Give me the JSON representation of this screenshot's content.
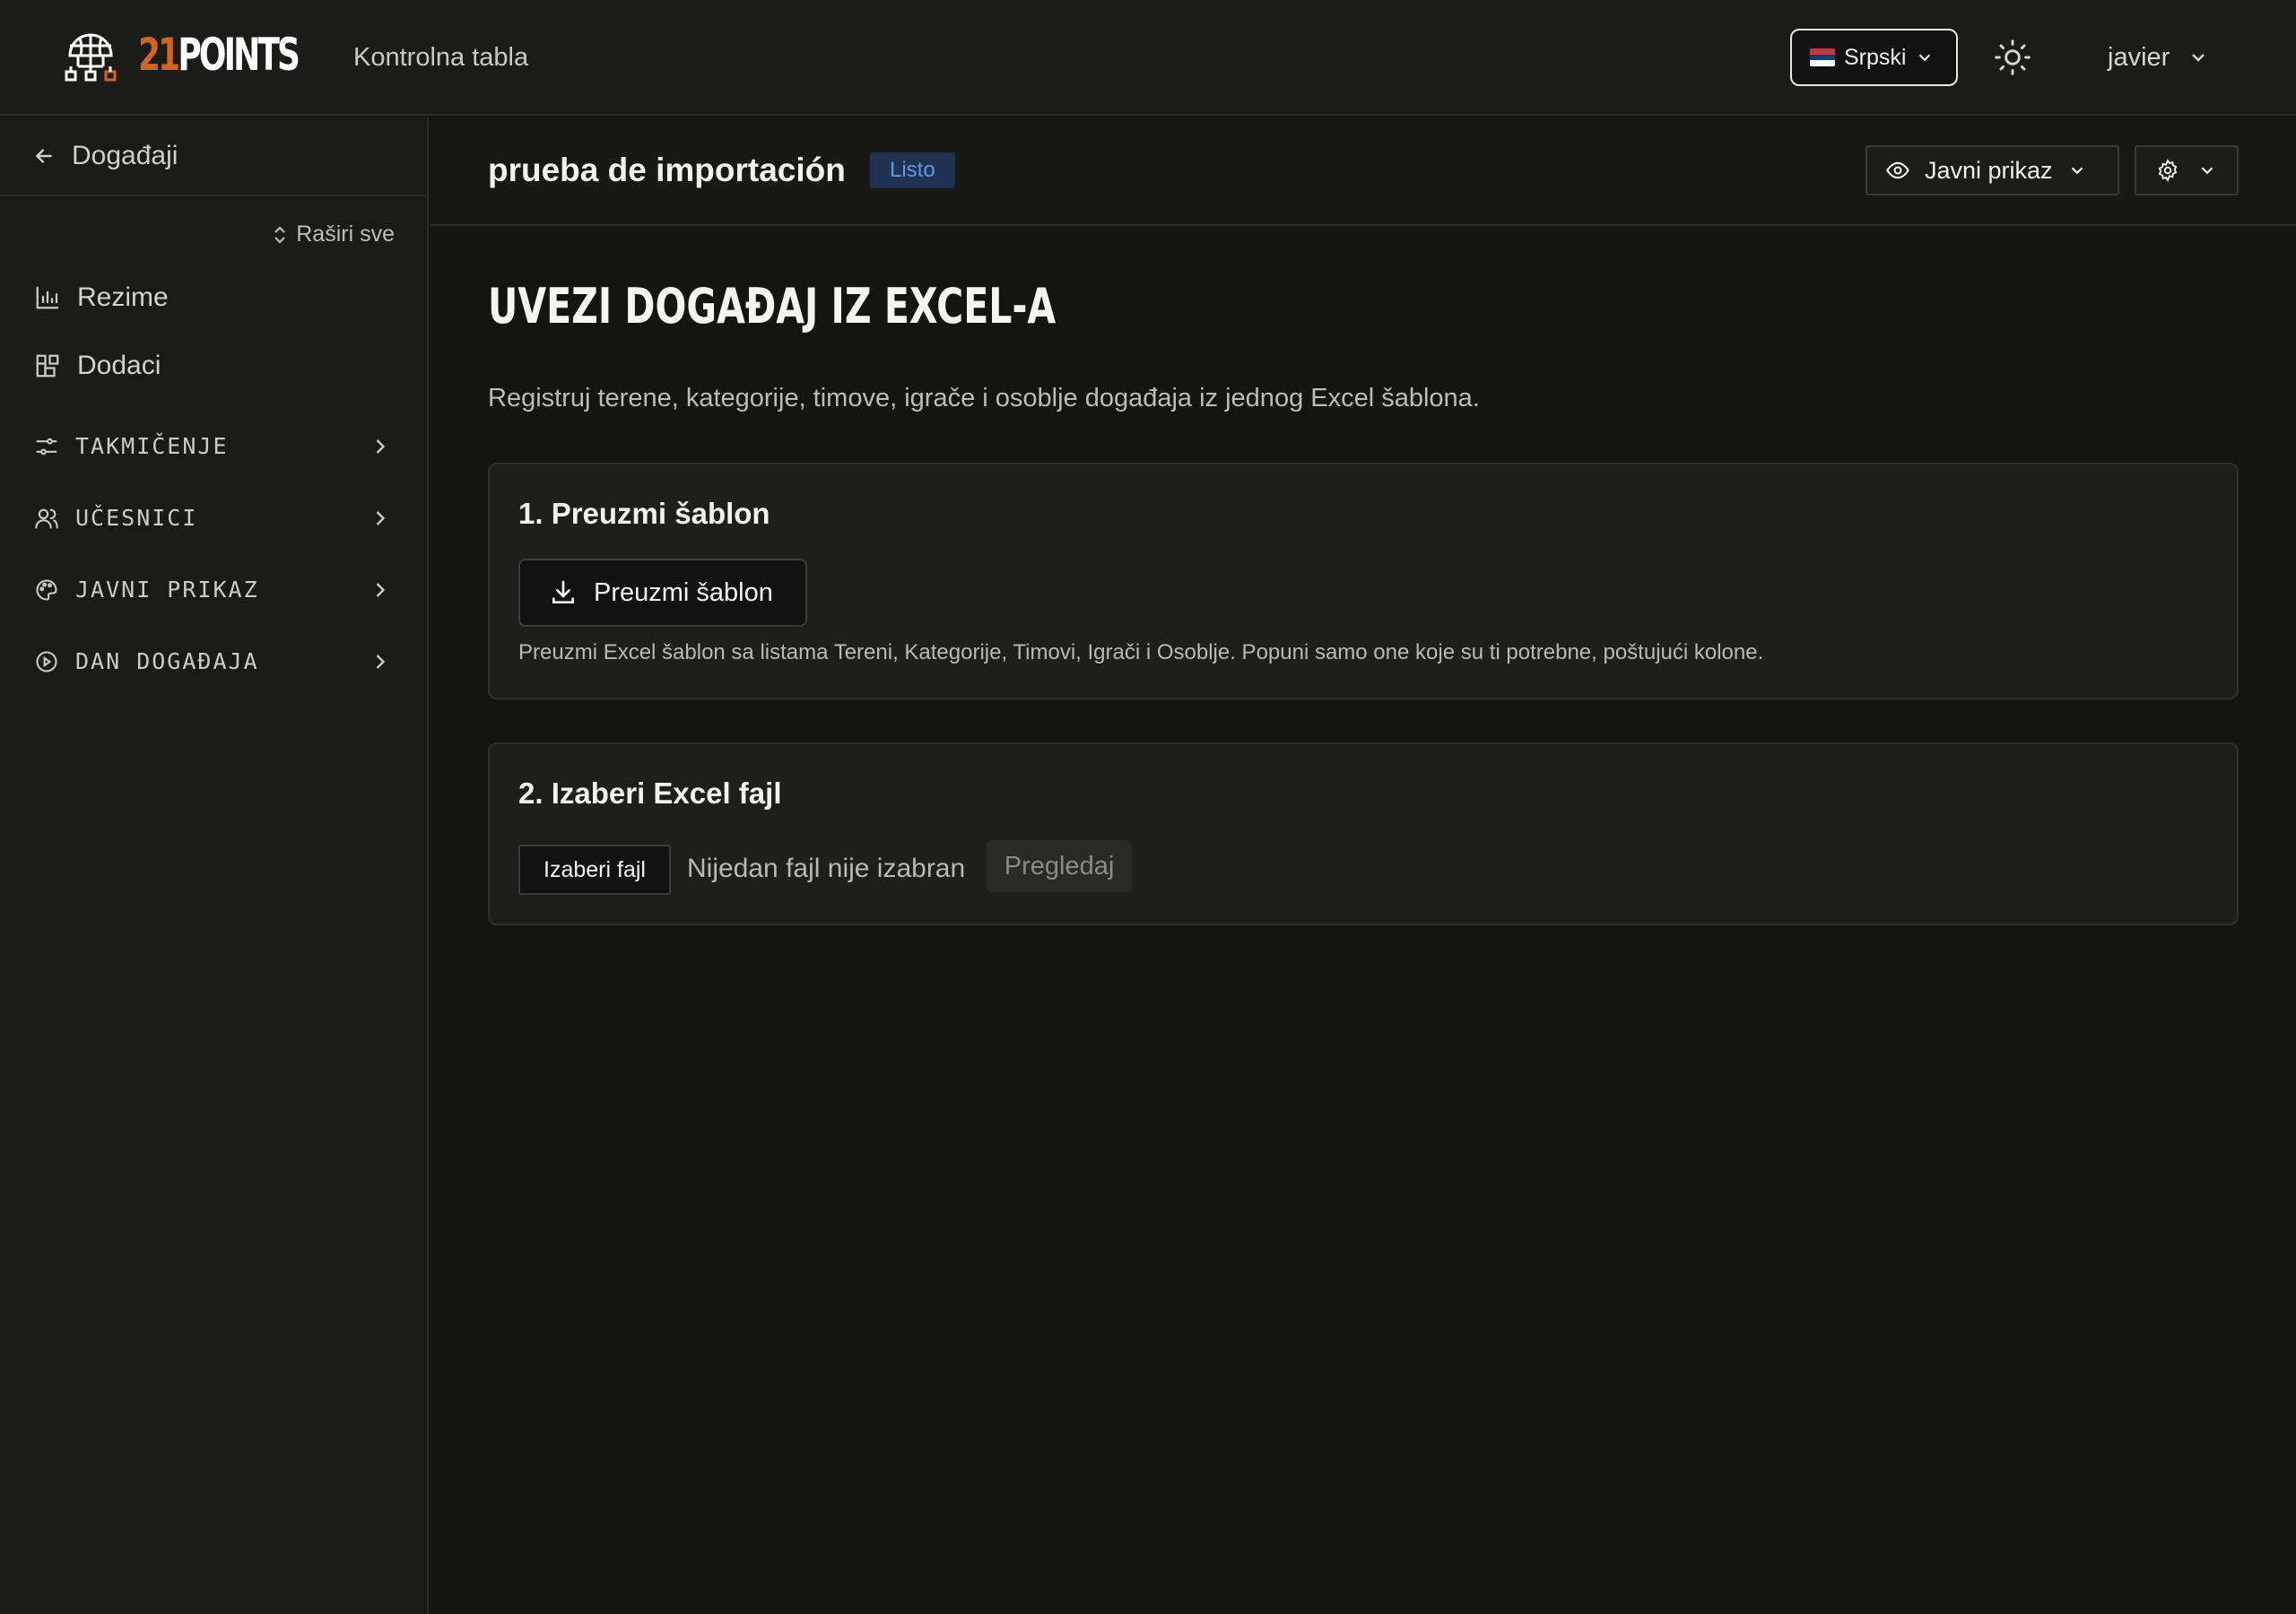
{
  "header": {
    "logo_number": "21",
    "logo_word": "POINTS",
    "dashboard_title": "Kontrolna tabla",
    "language_label": "Srpski",
    "user_name": "javier"
  },
  "sidebar": {
    "back_label": "Događaji",
    "expand_all_label": "Raširi sve",
    "items": [
      {
        "label": "Rezime",
        "icon": "chart-icon"
      },
      {
        "label": "Dodaci",
        "icon": "addons-icon"
      }
    ],
    "sections": [
      {
        "label": "TAKMIČENJE",
        "icon": "sliders-icon"
      },
      {
        "label": "UČESNICI",
        "icon": "users-icon"
      },
      {
        "label": "JAVNI PRIKAZ",
        "icon": "palette-icon"
      },
      {
        "label": "DAN DOGAĐAJA",
        "icon": "play-circle-icon"
      }
    ]
  },
  "event": {
    "title": "prueba de importación",
    "status_badge": "Listo",
    "public_view_label": "Javni prikaz"
  },
  "page": {
    "heading": "UVEZI DOGAĐAJ IZ EXCEL-A",
    "description": "Registruj terene, kategorije, timove, igrače i osoblje događaja iz jednog Excel šablona."
  },
  "step1": {
    "title": "1. Preuzmi šablon",
    "button_label": "Preuzmi šablon",
    "note": "Preuzmi Excel šablon sa listama Tereni, Kategorije, Timovi, Igrači i Osoblje. Popuni samo one koje su ti potrebne, poštujući kolone."
  },
  "step2": {
    "title": "2. Izaberi Excel fajl",
    "choose_file_label": "Izaberi fajl",
    "no_file_text": "Nijedan fajl nije izabran",
    "preview_label": "Pregledaj"
  },
  "colors": {
    "accent_orange": "#d2661f",
    "badge_blue": "#5b9ae8",
    "background": "#141412"
  }
}
